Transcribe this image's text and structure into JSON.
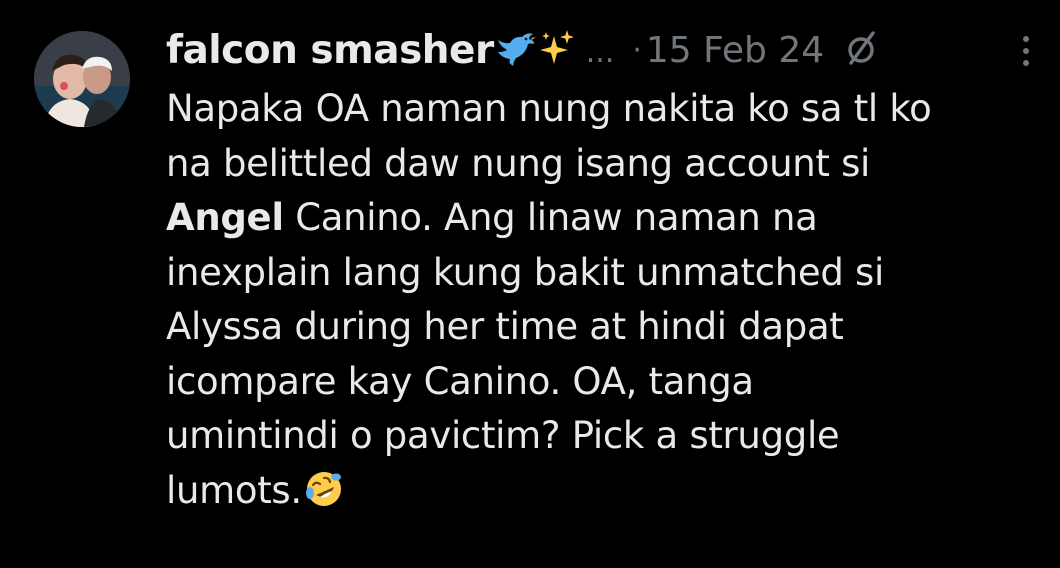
{
  "tweet": {
    "author_name": "falcon smasher",
    "name_emojis": [
      "bird-icon",
      "sparkle-icon"
    ],
    "ellipsis": "...",
    "separator": "·",
    "date": "15 Feb 24",
    "reply_restriction_icon": "no-reply-icon",
    "more_icon": "vertical-ellipsis-icon",
    "lines": [
      "Napaka OA naman nung nakita ko sa tl ko",
      "na belittled daw nung isang account si",
      {
        "bold": "Angel",
        "rest": " Canino. Ang linaw naman na"
      },
      "inexplain lang kung bakit unmatched si",
      "Alyssa during her time at hindi dapat",
      "icompare kay Canino. OA, tanga",
      "umintindi o pavictim? Pick a struggle",
      "lumots."
    ],
    "line3_bold": "Angel",
    "line3_rest": " Canino. Ang linaw naman na",
    "trailing_emoji": "rofl-icon",
    "colors": {
      "background": "#000000",
      "text": "#e7e9ea",
      "muted": "#71767b",
      "bird": "#55acee",
      "sparkle": "#ffcc4d"
    }
  }
}
